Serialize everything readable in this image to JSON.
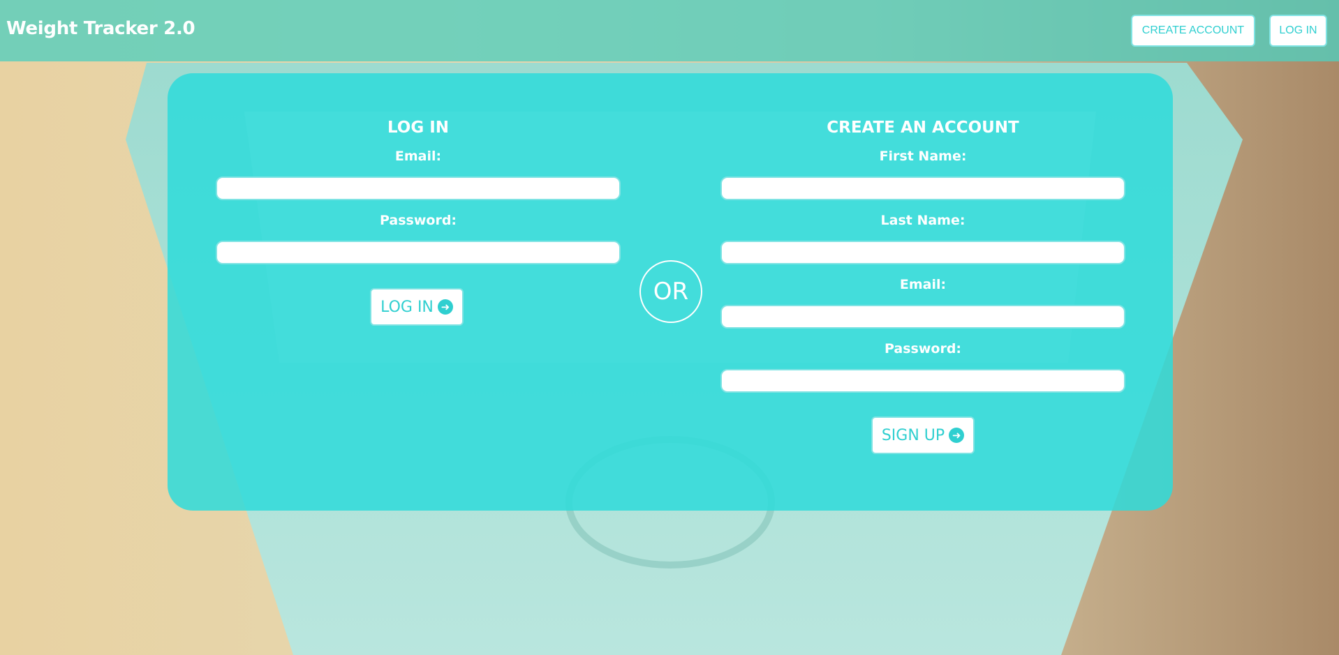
{
  "header": {
    "brand": "Weight Tracker 2.0",
    "nav_create": "CREATE ACCOUNT",
    "nav_login": "LOG IN"
  },
  "login": {
    "title": "LOG IN",
    "email_label": "Email:",
    "email_value": "",
    "password_label": "Password:",
    "password_value": "",
    "button_label": "LOG IN",
    "button_icon": "arrow-circle-right-icon"
  },
  "divider": {
    "label": "OR"
  },
  "signup": {
    "title": "CREATE AN ACCOUNT",
    "first_name_label": "First Name:",
    "first_name_value": "",
    "last_name_label": "Last Name:",
    "last_name_value": "",
    "email_label": "Email:",
    "email_value": "",
    "password_label": "Password:",
    "password_value": "",
    "button_label": "SIGN UP",
    "button_icon": "arrow-circle-right-icon"
  },
  "colors": {
    "accent": "#2fcfd0",
    "panel": "#2edbda",
    "topbar": "#52cebe"
  }
}
